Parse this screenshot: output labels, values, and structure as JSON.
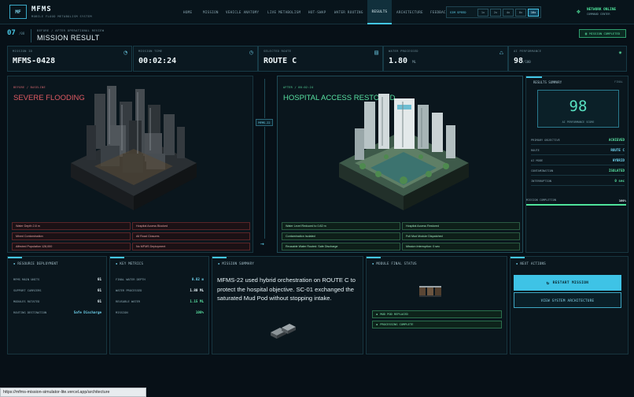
{
  "app": {
    "logo": "MF",
    "name": "MFMS",
    "subtitle": "MOBILE FLOOD METABOLISM SYSTEM"
  },
  "nav": {
    "items": [
      "HOME",
      "MISSION",
      "VEHICLE ANATOMY",
      "LIVE METABOLISM",
      "HOT-SWAP",
      "WATER ROUTING",
      "RESULTS",
      "ARCHITECTURE",
      "FEEDBACK"
    ],
    "active": "RESULTS"
  },
  "sim_speed": {
    "label": "SIM SPEED",
    "options": [
      "1x",
      "2x",
      "4x",
      "8x",
      "16x"
    ],
    "selected": "16x"
  },
  "network": {
    "status": "NETWORK ONLINE",
    "detail": "COMMAND CENTER"
  },
  "header": {
    "number": "07",
    "number_total": "/08",
    "breadcrumb": "BEFORE / AFTER OPERATIONAL REVIEW",
    "title": "MISSION RESULT",
    "badge": "MISSION COMPLETED"
  },
  "stats": [
    {
      "label": "MISSION ID",
      "value": "MFMS-0428",
      "unit": "",
      "icon": "gauge-icon"
    },
    {
      "label": "MISSION TIME",
      "value": "00:02:24",
      "unit": "",
      "icon": "clock-icon"
    },
    {
      "label": "SELECTED ROUTE",
      "value": "ROUTE C",
      "unit": "",
      "icon": "map-icon"
    },
    {
      "label": "WATER PROCESSED",
      "value": "1.80",
      "unit": "ML",
      "icon": "droplet-icon"
    },
    {
      "label": "AI PERFORMANCE",
      "value": "98",
      "unit": "/100",
      "icon": "sparkle-icon"
    }
  ],
  "before": {
    "tag": "BEFORE / BASELINE",
    "title": "SEVERE FLOODING",
    "chips": [
      "Water Depth 2.8 m",
      "Hospital Access Blocked",
      "Mixed Contamination",
      "All Road Closures",
      "Affected Population 128,000",
      "No MFMS Deployment"
    ]
  },
  "connector": {
    "label": "MFMS-22"
  },
  "after": {
    "tag": "AFTER / 00:02:24",
    "title": "HOSPITAL ACCESS RESTORED",
    "chips": [
      "Water Level Reduced to 0.82 m",
      "Hospital Access Restored",
      "Contamination Isolated",
      "Full Mud Module Dispatched",
      "Reusable Water Routed: Safe Discharge",
      "Mission Interruption: 0 sec"
    ]
  },
  "results": {
    "title": "RESULTS SUMMARY",
    "tag": "FINAL",
    "score": "98",
    "score_label": "AI PERFORMANCE SCORE",
    "rows": [
      {
        "k": "PRIMARY OBJECTIVE",
        "v": "ACHIEVED",
        "color": "#58e0a1"
      },
      {
        "k": "ROUTE",
        "v": "ROUTE C",
        "color": "#6fd3ee"
      },
      {
        "k": "AI MODE",
        "v": "HYBRID",
        "color": "#6fd3ee"
      },
      {
        "k": "CONTAMINATION",
        "v": "ISOLATED",
        "color": "#58e0a1"
      },
      {
        "k": "INTERRUPTION",
        "v": "0 sec",
        "color": "#58e0a1"
      }
    ],
    "completion_label": "MISSION COMPLETION",
    "completion_value": "100%",
    "completion_fraction": 1.0
  },
  "deployment": {
    "title": "RESOURCE DEPLOYMENT",
    "rows": [
      {
        "k": "MFMS MAIN UNITS",
        "v": "01"
      },
      {
        "k": "SUPPORT CARRIERS",
        "v": "01"
      },
      {
        "k": "MODULES ROTATED",
        "v": "01"
      },
      {
        "k": "ROUTING DESTINATION",
        "v": "Safe Discharge"
      }
    ]
  },
  "metrics": {
    "title": "KEY METRICS",
    "rows": [
      {
        "k": "FINAL WATER DEPTH",
        "v": "0.82 m"
      },
      {
        "k": "WATER PROCESSED",
        "v": "1.80 ML"
      },
      {
        "k": "REUSABLE WATER",
        "v": "1.15 ML"
      },
      {
        "k": "MISSION",
        "v": "100%"
      }
    ]
  },
  "summary": {
    "title": "MISSION SUMMARY",
    "text": "MFMS-22 used hybrid orchestration on ROUTE C to protect the hospital objective. SC-01 exchanged the saturated Mud Pod without stopping intake."
  },
  "module": {
    "title": "MODULE FINAL STATUS",
    "items": [
      "MUD POD REPLACED",
      "PROCESSING COMPLETE"
    ]
  },
  "actions": {
    "title": "NEXT ACTIONS",
    "restart": "RESTART MISSION",
    "architecture": "VIEW SYSTEM ARCHITECTURE"
  },
  "statusbar": {
    "url": "https://mfms-mission-simulator-lite.vercel.app/architecture"
  }
}
